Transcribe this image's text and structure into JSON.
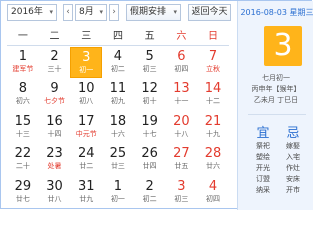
{
  "toolbar": {
    "year_value": "2016年",
    "prev_label": "‹",
    "month_value": "8月",
    "next_label": "›",
    "holiday_label": "假期安排",
    "today_label": "返回今天",
    "dropdown_glyph": "▾"
  },
  "weekdays": [
    "一",
    "二",
    "三",
    "四",
    "五",
    "六",
    "日"
  ],
  "weeks": [
    [
      {
        "day": "1",
        "lunar": "建军节",
        "festival": true,
        "weekend": false,
        "today": false
      },
      {
        "day": "2",
        "lunar": "三十",
        "festival": false,
        "weekend": false,
        "today": false
      },
      {
        "day": "3",
        "lunar": "初一",
        "festival": false,
        "weekend": false,
        "today": true
      },
      {
        "day": "4",
        "lunar": "初二",
        "festival": false,
        "weekend": false,
        "today": false
      },
      {
        "day": "5",
        "lunar": "初三",
        "festival": false,
        "weekend": false,
        "today": false
      },
      {
        "day": "6",
        "lunar": "初四",
        "festival": false,
        "weekend": true,
        "today": false
      },
      {
        "day": "7",
        "lunar": "立秋",
        "festival": true,
        "weekend": true,
        "today": false
      }
    ],
    [
      {
        "day": "8",
        "lunar": "初六",
        "festival": false,
        "weekend": false,
        "today": false
      },
      {
        "day": "9",
        "lunar": "七夕节",
        "festival": true,
        "weekend": false,
        "today": false
      },
      {
        "day": "10",
        "lunar": "初八",
        "festival": false,
        "weekend": false,
        "today": false
      },
      {
        "day": "11",
        "lunar": "初九",
        "festival": false,
        "weekend": false,
        "today": false
      },
      {
        "day": "12",
        "lunar": "初十",
        "festival": false,
        "weekend": false,
        "today": false
      },
      {
        "day": "13",
        "lunar": "十一",
        "festival": false,
        "weekend": true,
        "today": false
      },
      {
        "day": "14",
        "lunar": "十二",
        "festival": false,
        "weekend": true,
        "today": false
      }
    ],
    [
      {
        "day": "15",
        "lunar": "十三",
        "festival": false,
        "weekend": false,
        "today": false
      },
      {
        "day": "16",
        "lunar": "十四",
        "festival": false,
        "weekend": false,
        "today": false
      },
      {
        "day": "17",
        "lunar": "中元节",
        "festival": true,
        "weekend": false,
        "today": false
      },
      {
        "day": "18",
        "lunar": "十六",
        "festival": false,
        "weekend": false,
        "today": false
      },
      {
        "day": "19",
        "lunar": "十七",
        "festival": false,
        "weekend": false,
        "today": false
      },
      {
        "day": "20",
        "lunar": "十八",
        "festival": false,
        "weekend": true,
        "today": false
      },
      {
        "day": "21",
        "lunar": "十九",
        "festival": false,
        "weekend": true,
        "today": false
      }
    ],
    [
      {
        "day": "22",
        "lunar": "二十",
        "festival": false,
        "weekend": false,
        "today": false
      },
      {
        "day": "23",
        "lunar": "处暑",
        "festival": true,
        "weekend": false,
        "today": false
      },
      {
        "day": "24",
        "lunar": "廿二",
        "festival": false,
        "weekend": false,
        "today": false
      },
      {
        "day": "25",
        "lunar": "廿三",
        "festival": false,
        "weekend": false,
        "today": false
      },
      {
        "day": "26",
        "lunar": "廿四",
        "festival": false,
        "weekend": false,
        "today": false
      },
      {
        "day": "27",
        "lunar": "廿五",
        "festival": false,
        "weekend": true,
        "today": false
      },
      {
        "day": "28",
        "lunar": "廿六",
        "festival": false,
        "weekend": true,
        "today": false
      }
    ],
    [
      {
        "day": "29",
        "lunar": "廿七",
        "festival": false,
        "weekend": false,
        "today": false
      },
      {
        "day": "30",
        "lunar": "廿八",
        "festival": false,
        "weekend": false,
        "today": false
      },
      {
        "day": "31",
        "lunar": "廿九",
        "festival": false,
        "weekend": false,
        "today": false
      },
      {
        "day": "1",
        "lunar": "初一",
        "festival": false,
        "weekend": false,
        "today": false
      },
      {
        "day": "2",
        "lunar": "初二",
        "festival": false,
        "weekend": false,
        "today": false
      },
      {
        "day": "3",
        "lunar": "初三",
        "festival": false,
        "weekend": true,
        "today": false
      },
      {
        "day": "4",
        "lunar": "初四",
        "festival": false,
        "weekend": true,
        "today": false
      }
    ]
  ],
  "panel": {
    "date_line": "2016-08-03 星期三",
    "big_day": "3",
    "lunar_line1": "七月初一",
    "lunar_line2": "丙申年【猴年】",
    "lunar_line3": "乙未月 丁巳日",
    "yi_label": "宜",
    "ji_label": "忌",
    "yi_items": [
      "祭祀",
      "塑绘",
      "开光",
      "订盟",
      "纳采"
    ],
    "ji_items": [
      "嫁娶",
      "入宅",
      "作灶",
      "安床",
      "开市"
    ]
  },
  "colors": {
    "accent": "#ffb41a",
    "weekend_red": "#e33b2e",
    "link_blue": "#2b6fd1",
    "panel_bg": "#eef4fd"
  }
}
